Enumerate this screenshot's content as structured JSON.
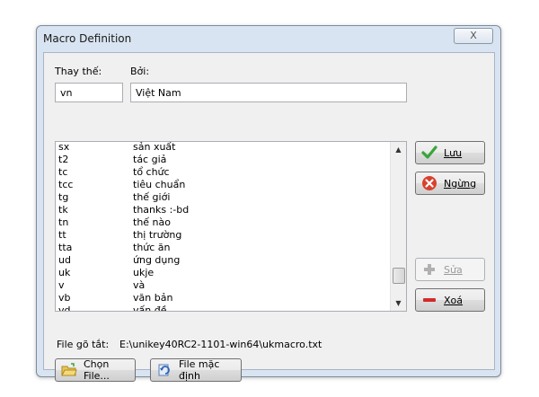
{
  "window": {
    "title": "Macro Definition",
    "close_label": "X"
  },
  "form": {
    "replace_label": "Thay thế:",
    "by_label": "Bởi:",
    "replace_value": "vn",
    "by_value": "Việt Nam"
  },
  "macros": [
    {
      "key": "sx",
      "value": "sản xuất"
    },
    {
      "key": "t2",
      "value": "tác giả"
    },
    {
      "key": "tc",
      "value": "tổ chức"
    },
    {
      "key": "tcc",
      "value": "tiêu chuẩn"
    },
    {
      "key": "tg",
      "value": "thế giới"
    },
    {
      "key": "tk",
      "value": "thanks :-bd"
    },
    {
      "key": "tn",
      "value": "thế nào"
    },
    {
      "key": "tt",
      "value": "thị trường"
    },
    {
      "key": "tta",
      "value": "thức ăn"
    },
    {
      "key": "ud",
      "value": "ứng dụng"
    },
    {
      "key": "uk",
      "value": "ukje"
    },
    {
      "key": "v",
      "value": "và"
    },
    {
      "key": "vb",
      "value": "văn bản"
    },
    {
      "key": "vd",
      "value": "vấn đề"
    }
  ],
  "buttons": {
    "save": "Lưu",
    "cancel": "Ngừng",
    "edit": "Sửa",
    "delete": "Xoá",
    "choose_file": "Chọn File...",
    "default_file": "File mặc định"
  },
  "file": {
    "label": "File gõ tắt:",
    "path": "E:\\unikey40RC2-1101-win64\\ukmacro.txt"
  },
  "colors": {
    "save_icon": "#3aa53a",
    "cancel_icon": "#d9402f",
    "delete_icon": "#d32b2b",
    "edit_icon_disabled": "#b0b0b0"
  }
}
